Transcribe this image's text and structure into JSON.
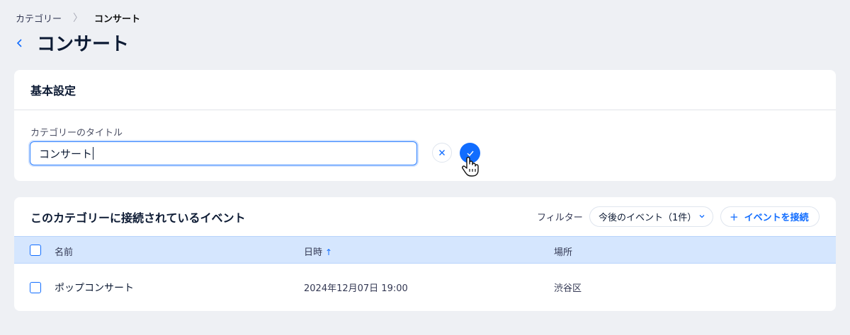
{
  "breadcrumb": {
    "parent": "カテゴリー",
    "separator": "〉",
    "current": "コンサート"
  },
  "page": {
    "title": "コンサート"
  },
  "basic_settings": {
    "header": "基本設定",
    "field_label": "カテゴリーのタイトル",
    "field_value": "コンサート"
  },
  "events_section": {
    "header": "このカテゴリーに接続されているイベント",
    "filter_label": "フィルター",
    "filter_value": "今後のイベント（1件）",
    "connect_button": "イベントを接続",
    "columns": {
      "name": "名前",
      "datetime": "日時",
      "location": "場所"
    },
    "rows": [
      {
        "name": "ポップコンサート",
        "datetime": "2024年12月07日 19:00",
        "location": "渋谷区"
      }
    ]
  },
  "colors": {
    "accent": "#116dff",
    "header_bg": "#d5e6fe",
    "page_bg": "#eef0f4"
  }
}
